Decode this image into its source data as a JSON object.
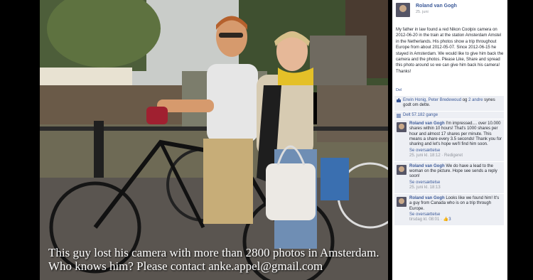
{
  "post": {
    "owner_name": "Roland van Gogh",
    "date": "25. juni",
    "text": "My father in law found a red Nikon Coolpix camera on 2012-06-20 in the train at the station Amsterdam Amstel in the Netherlands. His photos show a trip throughout Europe from about 2012-05-07. Since 2012-06-15 he stayed in Amsterdam. We would like to give him back the camera and the photos. Please Like, Share and spread this photo around so we can give him back his camera! Thanks!",
    "share_link": "Del",
    "likes_text_names": "Erwin Honig, Peter Bredewoud",
    "likes_text_mid": " og ",
    "likes_text_others": "2 andre",
    "likes_text_end": " synes godt om dette.",
    "shares_text": "Delt 57.182 gange"
  },
  "photo": {
    "caption_line1": "This guy lost his camera with more than 2800 photos in Amsterdam.",
    "caption_line2": "Who knows him? Please contact anke.appel@gmail.com"
  },
  "comments": [
    {
      "author": "Roland van Gogh",
      "text": "I'm impressed.... over 10.000 shares within 10 hours! That's 1000 shares per hour and almost 17 shares per minute. This means a share every 3.5 seconds! Thank you for sharing and let's hope we'll find him soon.",
      "translate": "Se oversættelse",
      "meta": "25. juni kl. 18:12 · Redigeret"
    },
    {
      "author": "Roland van Gogh",
      "text": "We do have a lead to the woman on the picture. Hope see sends a reply soon!",
      "translate": "Se oversættelse",
      "meta": "25. juni kl. 18:13"
    },
    {
      "author": "Roland van Gogh",
      "text": "Looks like we found him! It's a guy from Canada who is on a trip through Europe.",
      "translate": "Se oversættelse",
      "meta": "tirsdag kl. 08:01 · ",
      "like_count": "3"
    }
  ],
  "colors": {
    "link": "#3b5998",
    "panel": "#edeff4"
  }
}
